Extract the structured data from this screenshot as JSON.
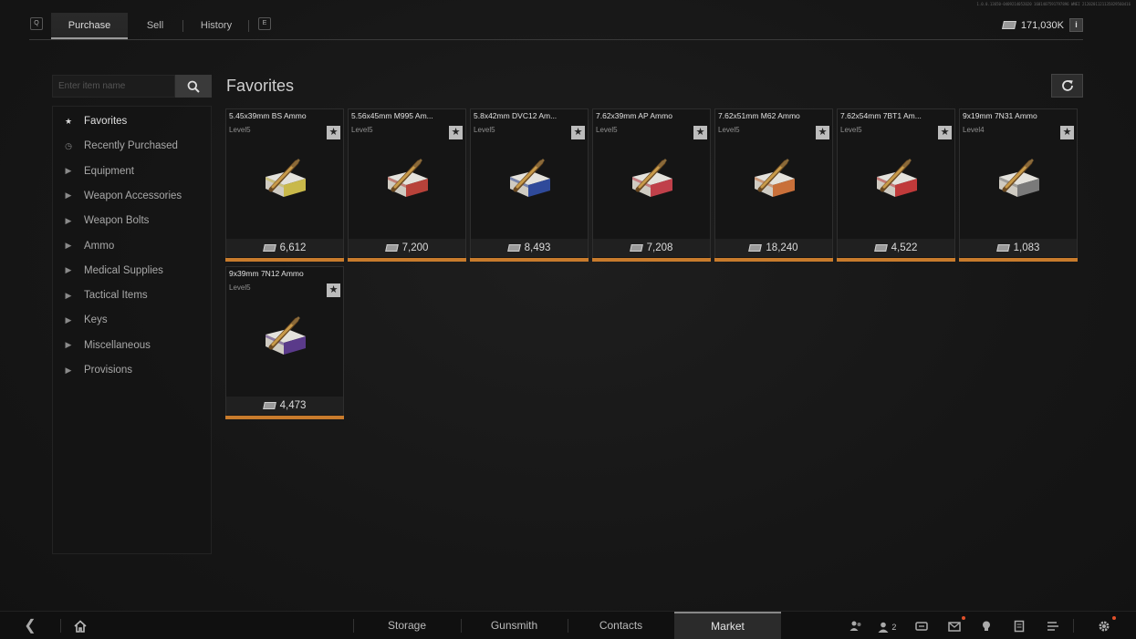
{
  "build_id": "1.0.0.13650-0409214052020 1601407591797896 WNEI 2120201121135829560416",
  "top_tabs": {
    "key_left": "Q",
    "purchase": "Purchase",
    "sell": "Sell",
    "history": "History",
    "key_right": "E"
  },
  "currency": {
    "amount": "171,030K",
    "info": "i"
  },
  "search": {
    "placeholder": "Enter item name"
  },
  "section_title": "Favorites",
  "sidebar": {
    "items": [
      {
        "label": "Favorites",
        "icon": "star-icon",
        "glyph": "★"
      },
      {
        "label": "Recently Purchased",
        "icon": "clock-icon",
        "glyph": "◷"
      },
      {
        "label": "Equipment",
        "icon": "triangle-right-icon",
        "glyph": "▶"
      },
      {
        "label": "Weapon Accessories",
        "icon": "triangle-right-icon",
        "glyph": "▶"
      },
      {
        "label": "Weapon Bolts",
        "icon": "triangle-right-icon",
        "glyph": "▶"
      },
      {
        "label": "Ammo",
        "icon": "triangle-right-icon",
        "glyph": "▶"
      },
      {
        "label": "Medical Supplies",
        "icon": "triangle-right-icon",
        "glyph": "▶"
      },
      {
        "label": "Tactical Items",
        "icon": "triangle-right-icon",
        "glyph": "▶"
      },
      {
        "label": "Keys",
        "icon": "triangle-right-icon",
        "glyph": "▶"
      },
      {
        "label": "Miscellaneous",
        "icon": "triangle-right-icon",
        "glyph": "▶"
      },
      {
        "label": "Provisions",
        "icon": "triangle-right-icon",
        "glyph": "▶"
      }
    ]
  },
  "items": [
    {
      "name": "5.45x39mm BS Ammo",
      "level": "Level5",
      "price": "6,612",
      "box_color": "#c9b94a"
    },
    {
      "name": "5.56x45mm M995 Am...",
      "level": "Level5",
      "price": "7,200",
      "box_color": "#b8423a"
    },
    {
      "name": "5.8x42mm DVC12 Am...",
      "level": "Level5",
      "price": "8,493",
      "box_color": "#2f4a9a"
    },
    {
      "name": "7.62x39mm AP Ammo",
      "level": "Level5",
      "price": "7,208",
      "box_color": "#c0404a"
    },
    {
      "name": "7.62x51mm M62 Ammo",
      "level": "Level5",
      "price": "18,240",
      "box_color": "#c9703a"
    },
    {
      "name": "7.62x54mm 7BT1 Am...",
      "level": "Level5",
      "price": "4,522",
      "box_color": "#c03a3a"
    },
    {
      "name": "9x19mm 7N31 Ammo",
      "level": "Level4",
      "price": "1,083",
      "box_color": "#7a7a7a"
    },
    {
      "name": "9x39mm 7N12 Ammo",
      "level": "Level5",
      "price": "4,473",
      "box_color": "#5a3a8a"
    }
  ],
  "bottom_nav": {
    "storage": "Storage",
    "gunsmith": "Gunsmith",
    "contacts": "Contacts",
    "market": "Market",
    "friends_count": "2"
  },
  "colors": {
    "rarity_bar": "#c87b2c",
    "accent_badge": "#e0502a"
  }
}
